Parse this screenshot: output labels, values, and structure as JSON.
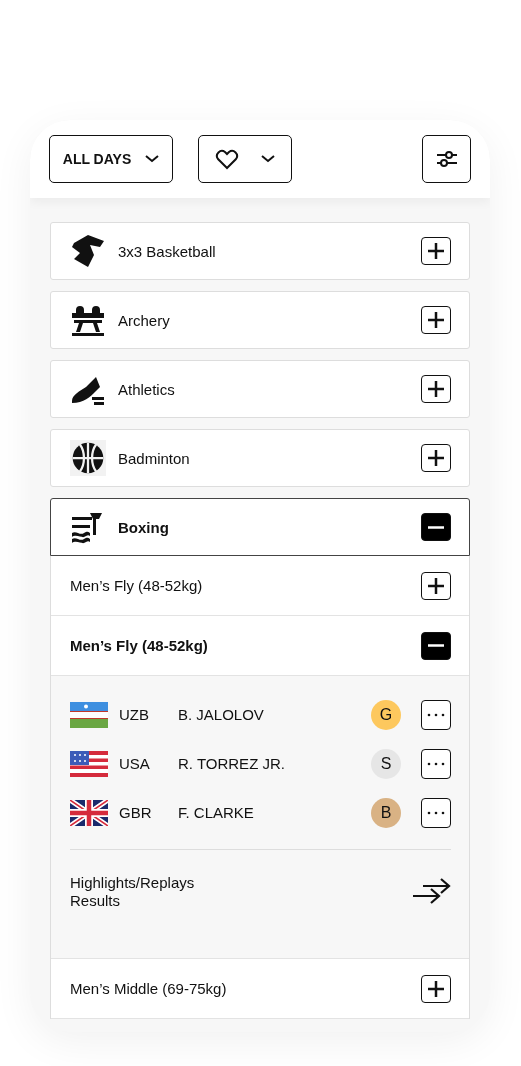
{
  "filters": {
    "day": "ALL DAYS"
  },
  "sports": [
    {
      "name": "3x3 Basketball",
      "kind": "block",
      "expanded": false
    },
    {
      "name": "Archery",
      "kind": "horse",
      "expanded": false
    },
    {
      "name": "Athletics",
      "kind": "shoe",
      "expanded": false
    },
    {
      "name": "Badminton",
      "kind": "ball",
      "expanded": false
    },
    {
      "name": "Boxing",
      "kind": "diving",
      "expanded": true,
      "events": [
        {
          "name": "Men’s Fly (48-52kg)",
          "expanded": false
        },
        {
          "name": "Men’s Fly (48-52kg)",
          "expanded": true,
          "results": [
            {
              "kind": "uzbekistan",
              "code": "UZB",
              "athlete": "B. JALOLOV",
              "medal": "G",
              "color": "#fdc85e"
            },
            {
              "kind": "usa",
              "code": "USA",
              "athlete": "R. TORREZ JR.",
              "medal": "S",
              "color": "#e6e6e6"
            },
            {
              "kind": "uk",
              "code": "GBR",
              "athlete": "F. CLARKE",
              "medal": "B",
              "color": "#d9b284"
            }
          ],
          "links": [
            "Highlights/Replays",
            "Results"
          ]
        },
        {
          "name": "Men’s Middle (69-75kg)",
          "expanded": false
        }
      ]
    }
  ]
}
